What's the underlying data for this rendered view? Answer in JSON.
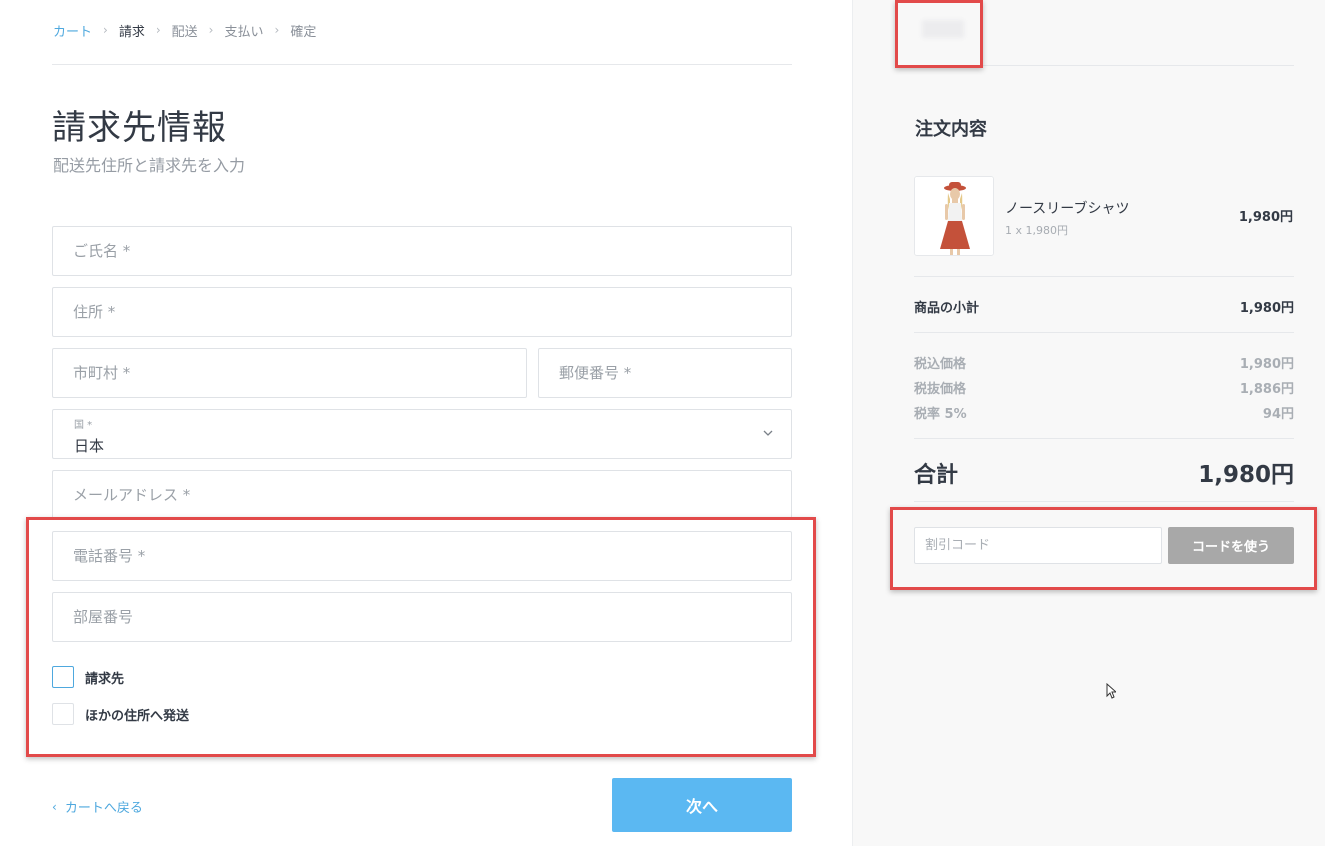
{
  "breadcrumb": [
    {
      "label": "カート",
      "state": "link"
    },
    {
      "label": "請求",
      "state": "current"
    },
    {
      "label": "配送",
      "state": "upcoming"
    },
    {
      "label": "支払い",
      "state": "upcoming"
    },
    {
      "label": "確定",
      "state": "upcoming"
    }
  ],
  "breadcrumb_separator": "›",
  "page": {
    "title": "請求先情報",
    "subtitle": "配送先住所と請求先を入力"
  },
  "form": {
    "name_placeholder": "ご氏名 *",
    "address_placeholder": "住所 *",
    "city_placeholder": "市町村 *",
    "postal_placeholder": "郵便番号 *",
    "country_label": "国 *",
    "country_value": "日本",
    "email_placeholder": "メールアドレス *",
    "phone_placeholder": "電話番号 *",
    "room_placeholder": "部屋番号",
    "checkbox_billing": "請求先",
    "checkbox_ship_other": "ほかの住所へ発送"
  },
  "footer": {
    "back_chevron": "‹",
    "back_label": "カートへ戻る",
    "next_label": "次へ"
  },
  "summary": {
    "title": "注文内容",
    "product": {
      "name": "ノースリーブシャツ",
      "qty": "1 x 1,980円",
      "price": "1,980円"
    },
    "subtotal_label": "商品の小計",
    "subtotal_value": "1,980円",
    "tax_rows": [
      {
        "label": "税込価格",
        "value": "1,980円"
      },
      {
        "label": "税抜価格",
        "value": "1,886円"
      },
      {
        "label": "税率 5%",
        "value": "94円"
      }
    ],
    "total_label": "合計",
    "total_value": "1,980円",
    "discount_placeholder": "割引コード",
    "discount_button": "コードを使う"
  },
  "colors": {
    "accent": "#4ea8de",
    "next_button": "#5bb8f2",
    "discount_button": "#a8a8a8",
    "annotation": "#e24a4a"
  },
  "icons": {
    "country_select": "chevron-down-icon",
    "back": "chevron-left-icon"
  }
}
